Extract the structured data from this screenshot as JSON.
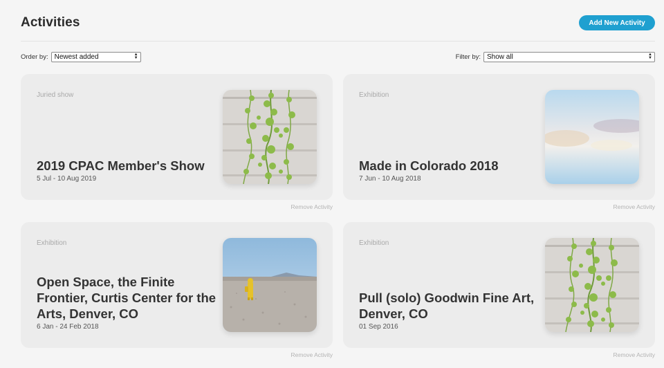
{
  "header": {
    "title": "Activities",
    "add_button": "Add New Activity"
  },
  "controls": {
    "order_label": "Order by:",
    "order_value": "Newest added",
    "filter_label": "Filter by:",
    "filter_value": "Show all"
  },
  "activities": [
    {
      "type": "Juried show",
      "title": "2019 CPAC Member's Show",
      "date": "5 Jul - 10 Aug 2019",
      "remove": "Remove Activity",
      "image": "vine-wall-image"
    },
    {
      "type": "Exhibition",
      "title": "Made in Colorado 2018",
      "date": "7 Jun - 10 Aug 2018",
      "remove": "Remove Activity",
      "image": "blurred-landscape-image"
    },
    {
      "type": "Exhibition",
      "title": "Open Space, the Finite Frontier, Curtis Center for the Arts, Denver, CO",
      "date": "6 Jan - 24 Feb 2018",
      "remove": "Remove Activity",
      "image": "desert-figure-image"
    },
    {
      "type": "Exhibition",
      "title": "Pull (solo) Goodwin Fine Art, Denver, CO",
      "date": "01 Sep 2016",
      "remove": "Remove Activity",
      "image": "vine-wall-image"
    }
  ],
  "colors": {
    "accent": "#1fa0d0",
    "card_bg": "#ececec",
    "page_bg": "#f5f5f5"
  }
}
